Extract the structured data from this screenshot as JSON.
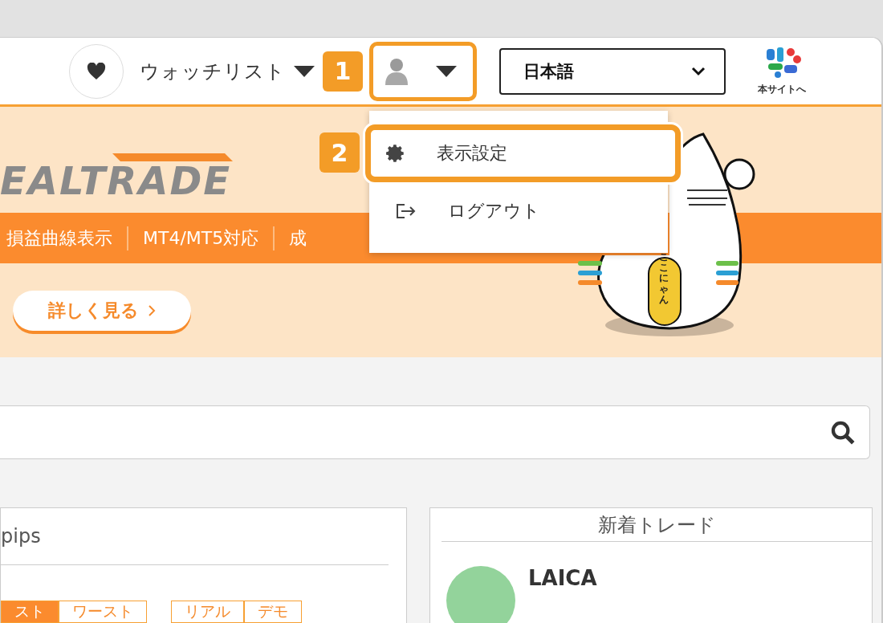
{
  "header": {
    "watchlist_label": "ウォッチリスト",
    "user_button": {
      "highlighted": true
    },
    "language": "日本語",
    "site_link": "本サイトへ"
  },
  "callouts": [
    "1",
    "2"
  ],
  "user_menu": {
    "expanded": true,
    "items": [
      {
        "kind": "settings",
        "label": "表示設定",
        "highlighted": true
      },
      {
        "kind": "logout",
        "label": "ログアウト",
        "highlighted": false
      }
    ]
  },
  "banner": {
    "logo": "EALTRADE",
    "features": [
      "損益曲線表示",
      "MT4/MT5対応",
      "成"
    ],
    "button": "詳しく見る",
    "mascot_text": "ここにゃん"
  },
  "ranking_card": {
    "title": "pips",
    "tabs": [
      {
        "label": "スト",
        "selected": true
      },
      {
        "label": "ワースト",
        "selected": false
      }
    ],
    "account_tabs": [
      {
        "label": "リアル",
        "selected": false
      },
      {
        "label": "デモ",
        "selected": false
      }
    ]
  },
  "new_trades_card": {
    "title": "新着トレード",
    "entries": [
      {
        "name": "LAICA"
      }
    ]
  }
}
